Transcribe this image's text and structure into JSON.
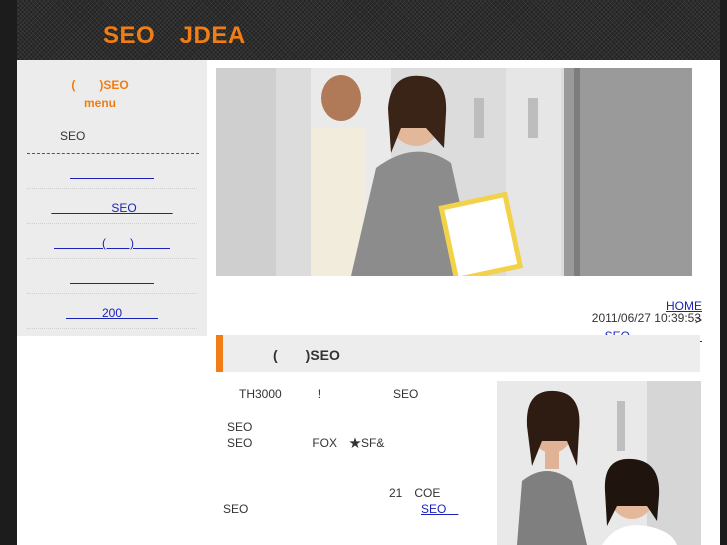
{
  "header": {
    "logo": "SEO　JDEA"
  },
  "sidebar": {
    "title": "(　　)SEO\nmenu",
    "subtitle": "SEO",
    "items": [
      {
        "label": "　　　　　　　"
      },
      {
        "label": "　　　　　SEO　　　"
      },
      {
        "label": "　　　　(　　)　　　"
      },
      {
        "label": "　　　　　　　"
      },
      {
        "label": "　　　200　　　"
      }
    ]
  },
  "breadcrumb": {
    "home": "HOME",
    "separator": ">",
    "current": "SEO　　　　　　"
  },
  "timestamp": "2011/06/27 10:39:53",
  "article": {
    "title": "(　　)SEO",
    "lines": [
      {
        "text": "　TH3000　　　!　　　　　　SEO"
      },
      {
        "text": "SEO"
      },
      {
        "text": "SEO　　　　　FOX　★SF&"
      },
      {
        "text": "21　COE"
      },
      {
        "text": "SEO"
      }
    ],
    "link": "SEO　"
  },
  "colors": {
    "accent": "#f07d15",
    "link": "#1a22b8",
    "header_bg": "#232323",
    "sidebar_bg": "#ececec"
  }
}
